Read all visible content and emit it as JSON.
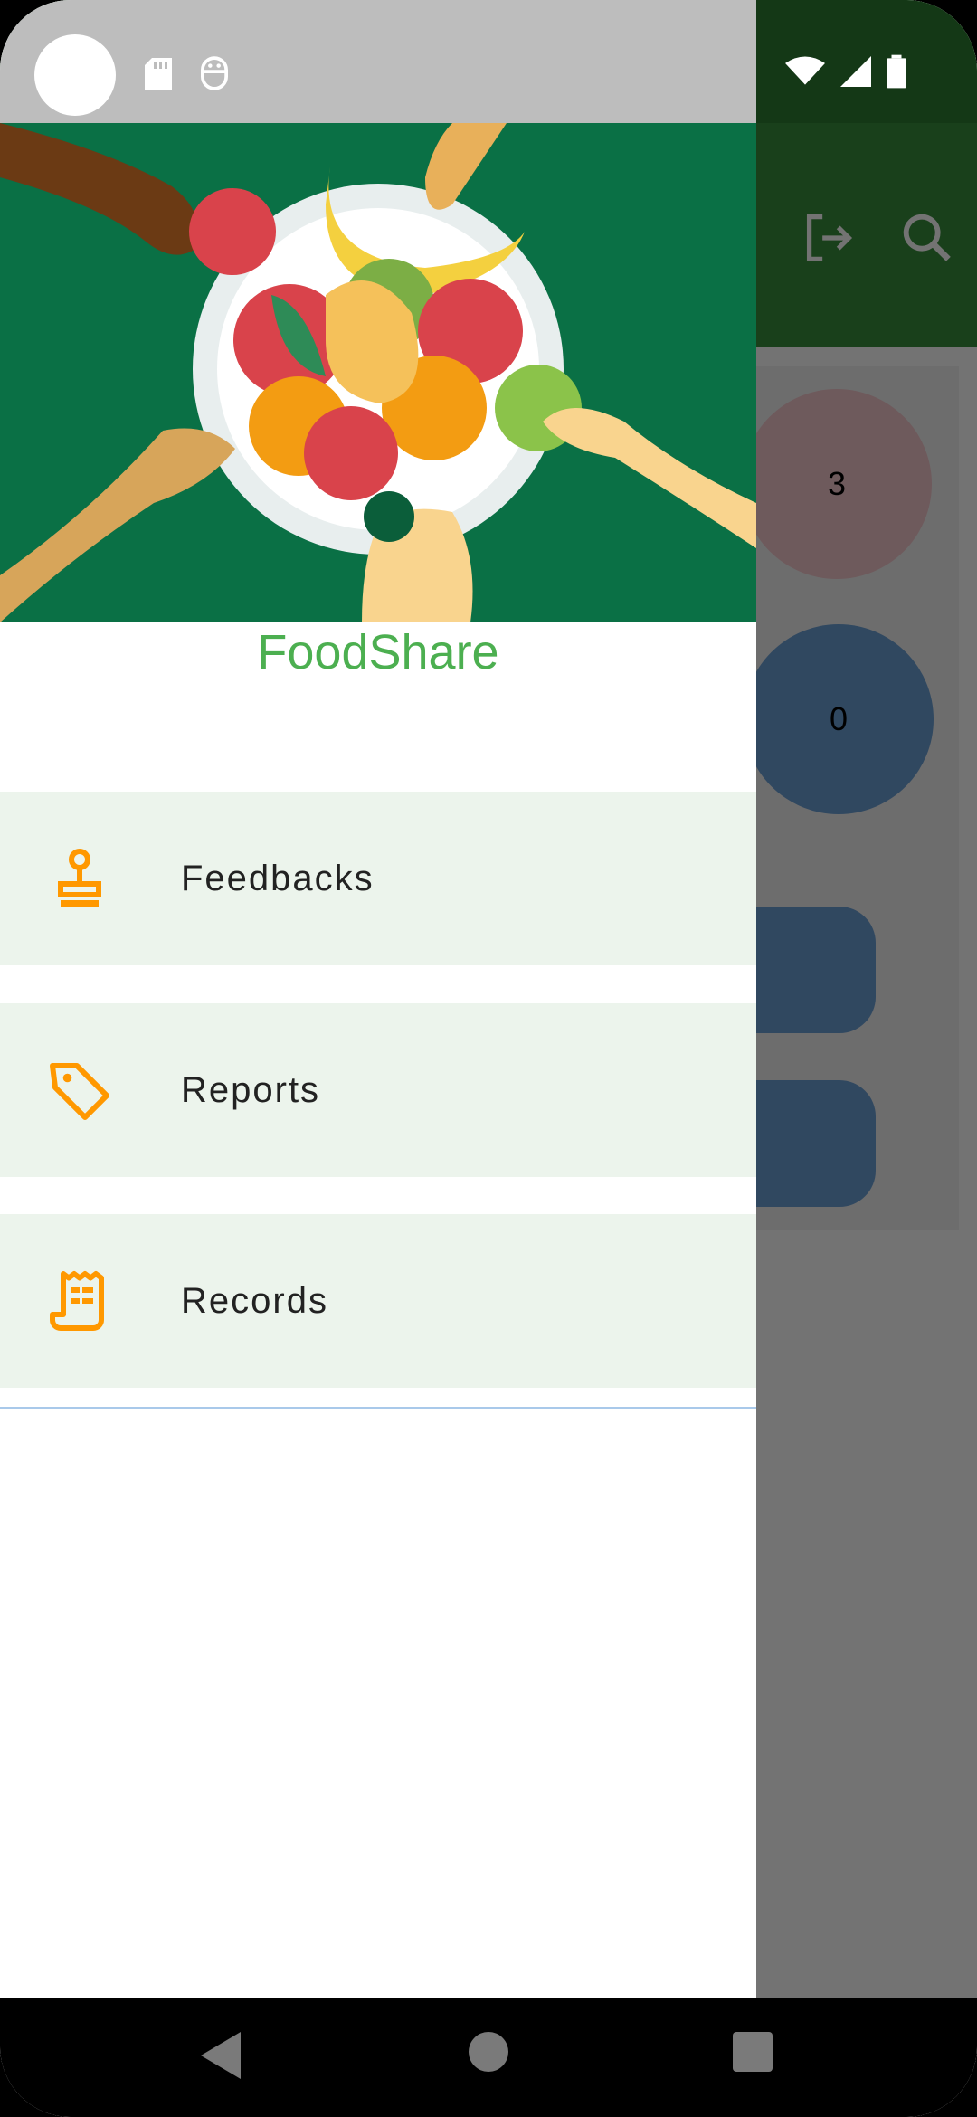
{
  "app": {
    "title": "FoodShare"
  },
  "background_app": {
    "toolbar_icons": [
      "logout-icon",
      "search-icon"
    ],
    "counters": [
      {
        "value": "3",
        "color": "#f4c7cd"
      },
      {
        "value": "0",
        "color": "#6b9fd6"
      }
    ]
  },
  "drawer": {
    "menu": [
      {
        "label": "Feedbacks",
        "icon": "stamp-icon"
      },
      {
        "label": "Reports",
        "icon": "tag-icon"
      },
      {
        "label": "Records",
        "icon": "receipt-icon"
      }
    ]
  },
  "status_bar": {
    "icons": [
      "sd-card-icon",
      "developer-icon",
      "wifi-icon",
      "signal-icon",
      "battery-icon"
    ]
  },
  "nav_bar": {
    "buttons": [
      "back-button",
      "home-button",
      "recents-button"
    ]
  },
  "colors": {
    "primary": "#388e3c",
    "accent": "#ff9800",
    "title": "#4caf50",
    "menu_bg": "#ecf4ec",
    "header_bg": "#0a7045"
  }
}
